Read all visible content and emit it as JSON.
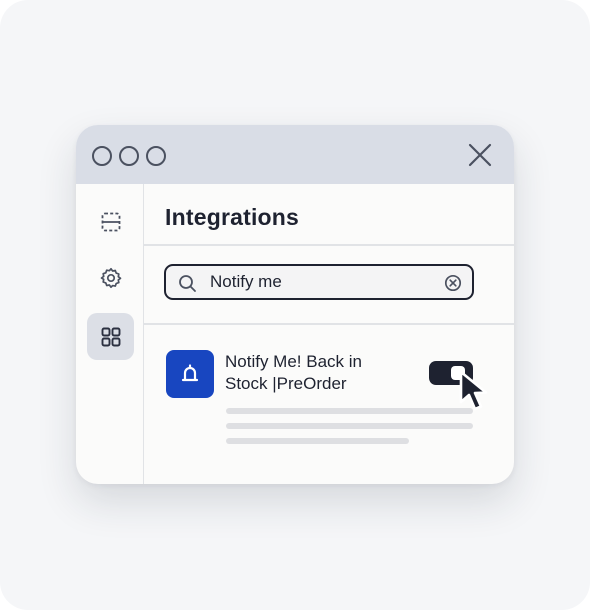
{
  "window": {
    "close_icon": "close-icon",
    "control_dots": [
      "circle-icon",
      "circle-icon",
      "circle-icon"
    ]
  },
  "sidebar": {
    "items": [
      {
        "icon": "list-layout-icon",
        "active": false
      },
      {
        "icon": "gear-icon",
        "active": false
      },
      {
        "icon": "grid-icon",
        "active": true
      }
    ]
  },
  "main": {
    "title": "Integrations",
    "search": {
      "value": "Notify me",
      "placeholder": "",
      "icon": "search-icon",
      "clear_icon": "clear-circle-icon"
    },
    "result": {
      "app_name": "Notify Me! Back in Stock |PreOrder",
      "app_icon": "bell-icon",
      "toggle_on": true
    }
  },
  "colors": {
    "titlebar": "#d9dde6",
    "app_icon_bg": "#1846c0",
    "text": "#1e2230",
    "toggle": "#1e2230"
  }
}
